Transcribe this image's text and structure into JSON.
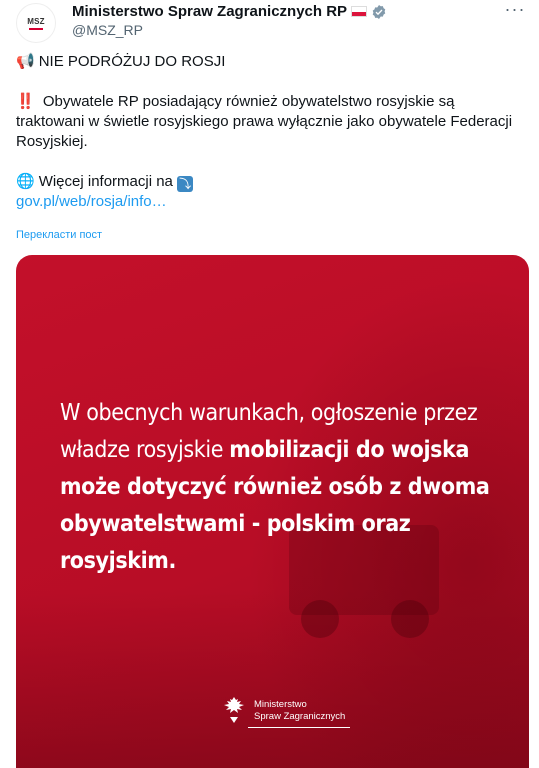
{
  "account": {
    "avatar_text": "MSZ",
    "name": "Ministerstwo Spraw Zagranicznych RP",
    "handle": "@MSZ_RP"
  },
  "tweet": {
    "headline_emoji": "📢",
    "headline": "NIE PODRÓŻUJ DO ROSJI",
    "warning_emoji": "‼️",
    "paragraph": "Obywatele RP posiadający również obywatelstwo rosyjskie są traktowani w świetle rosyjskiego prawa wyłącznie jako obywatele Federacji Rosyjskiej.",
    "info_emoji": "🌐",
    "info_text": "Więcej informacji na",
    "info_arrow": "⤵",
    "link": "gov.pl/web/rosja/info…",
    "translate": "Перекласти пост"
  },
  "media": {
    "text_normal": "W obecnych warunkach, ogłoszenie przez władze rosyjskie ",
    "text_bold": "mobilizacji do wojska może dotyczyć również osób z dwoma obywatelstwami - polskim oraz rosyjskim.",
    "logo_line1": "Ministerstwo",
    "logo_line2": "Spraw Zagranicznych",
    "background_color": "#c3102a"
  },
  "icons": {
    "more": "more-options-icon",
    "verified": "verified-badge-icon",
    "flag": "poland-flag-icon"
  }
}
